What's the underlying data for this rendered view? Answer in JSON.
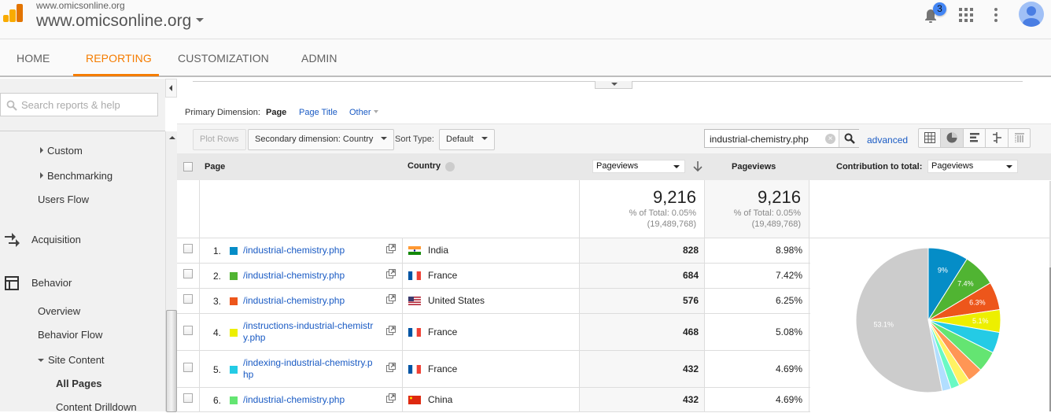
{
  "header": {
    "account_small": "www.omicsonline.org",
    "account_name": "www.omicsonline.org",
    "notification_count": "3",
    "icons": [
      "bell-icon",
      "apps-icon",
      "more-vert-icon",
      "avatar-icon"
    ]
  },
  "nav": {
    "tabs": [
      {
        "label": "HOME",
        "active": false
      },
      {
        "label": "REPORTING",
        "active": true
      },
      {
        "label": "CUSTOMIZATION",
        "active": false
      },
      {
        "label": "ADMIN",
        "active": false
      }
    ],
    "accent": "#f57c00"
  },
  "sidebar": {
    "search_placeholder": "Search reports & help",
    "items": [
      {
        "label": "Custom",
        "type": "collapsed"
      },
      {
        "label": "Benchmarking",
        "type": "collapsed"
      },
      {
        "label": "Users Flow",
        "type": "link"
      },
      {
        "label": "Acquisition",
        "type": "section"
      },
      {
        "label": "Behavior",
        "type": "section"
      },
      {
        "label": "Overview",
        "type": "link"
      },
      {
        "label": "Behavior Flow",
        "type": "link"
      },
      {
        "label": "Site Content",
        "type": "expanded"
      },
      {
        "label": "All Pages",
        "type": "active"
      },
      {
        "label": "Content Drilldown",
        "type": "link"
      }
    ]
  },
  "report": {
    "primary_dimension_label": "Primary Dimension:",
    "primary_dimension_options": [
      "Page",
      "Page Title",
      "Other"
    ],
    "plot_rows": "Plot Rows",
    "secondary_dimension": "Secondary dimension: Country",
    "sort_type_label": "Sort Type:",
    "sort_type": "Default",
    "filter_value": "industrial-chemistry.php",
    "advanced": "advanced",
    "view_modes": [
      "table",
      "pie",
      "bar",
      "comparison",
      "pivot"
    ],
    "active_view": "pie",
    "columns": {
      "page": "Page",
      "country": "Country",
      "metric_select": "Pageviews",
      "pageviews": "Pageviews",
      "contribution_label": "Contribution to total:",
      "contribution_select": "Pageviews"
    },
    "totals": [
      {
        "value": "9,216",
        "pct": "% of Total: 0.05%",
        "total": "(19,489,768)"
      },
      {
        "value": "9,216",
        "pct": "% of Total: 0.05%",
        "total": "(19,489,768)"
      }
    ],
    "rows": [
      {
        "num": "1.",
        "color": "#058dc7",
        "page": "/industrial-chemistry.php",
        "country": "India",
        "flag": "india",
        "pageviews": "828",
        "pct": "8.98%"
      },
      {
        "num": "2.",
        "color": "#50b432",
        "page": "/industrial-chemistry.php",
        "country": "France",
        "flag": "france",
        "pageviews": "684",
        "pct": "7.42%"
      },
      {
        "num": "3.",
        "color": "#ed561b",
        "page": "/industrial-chemistry.php",
        "country": "United States",
        "flag": "us",
        "pageviews": "576",
        "pct": "6.25%"
      },
      {
        "num": "4.",
        "color": "#edef00",
        "page": "/instructions-industrial-chemistr y.php",
        "country": "France",
        "flag": "france",
        "pageviews": "468",
        "pct": "5.08%"
      },
      {
        "num": "5.",
        "color": "#24cbe5",
        "page": "/indexing-industrial-chemistry.p hp",
        "country": "France",
        "flag": "france",
        "pageviews": "432",
        "pct": "4.69%"
      },
      {
        "num": "6.",
        "color": "#64e572",
        "page": "/industrial-chemistry.php",
        "country": "China",
        "flag": "china",
        "pageviews": "432",
        "pct": "4.69%"
      }
    ]
  },
  "chart_data": {
    "type": "pie",
    "title": "Contribution to total: Pageviews",
    "slices": [
      {
        "label": "9%",
        "value": 8.98,
        "color": "#058dc7"
      },
      {
        "label": "7.4%",
        "value": 7.42,
        "color": "#50b432"
      },
      {
        "label": "6.3%",
        "value": 6.25,
        "color": "#ed561b"
      },
      {
        "label": "5.1%",
        "value": 5.08,
        "color": "#edef00"
      },
      {
        "label": "",
        "value": 4.69,
        "color": "#24cbe5"
      },
      {
        "label": "",
        "value": 4.69,
        "color": "#64e572"
      },
      {
        "label": "",
        "value": 3.4,
        "color": "#ff9655"
      },
      {
        "label": "",
        "value": 2.4,
        "color": "#fff263"
      },
      {
        "label": "",
        "value": 2.0,
        "color": "#6af9c4"
      },
      {
        "label": "",
        "value": 2.0,
        "color": "#b2deff"
      },
      {
        "label": "53.1%",
        "value": 53.1,
        "color": "#cccccc"
      }
    ]
  }
}
